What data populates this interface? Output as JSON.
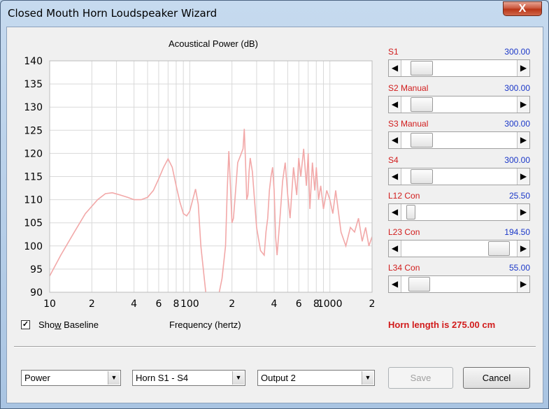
{
  "window": {
    "title": "Closed Mouth Horn Loudspeaker Wizard",
    "close_glyph": "X"
  },
  "chart": {
    "title": "Acoustical Power (dB)",
    "xlabel": "Frequency (hertz)"
  },
  "chart_data": {
    "type": "line",
    "title": "Acoustical Power (dB)",
    "xlabel": "Frequency (hertz)",
    "ylabel": "",
    "xscale": "log",
    "xlim": [
      10,
      2000
    ],
    "ylim": [
      90,
      140
    ],
    "yticks": [
      "140",
      "135",
      "130",
      "125",
      "120",
      "115",
      "110",
      "105",
      "100",
      "95",
      "90"
    ],
    "xticks": [
      {
        "v": 10,
        "label": "10"
      },
      {
        "v": 20,
        "label": "2"
      },
      {
        "v": 40,
        "label": "4"
      },
      {
        "v": 60,
        "label": "6"
      },
      {
        "v": 80,
        "label": "8"
      },
      {
        "v": 100,
        "label": "100"
      },
      {
        "v": 200,
        "label": "2"
      },
      {
        "v": 400,
        "label": "4"
      },
      {
        "v": 600,
        "label": "6"
      },
      {
        "v": 800,
        "label": "8"
      },
      {
        "v": 1000,
        "label": "1000"
      },
      {
        "v": 2000,
        "label": "2"
      }
    ],
    "grid": true,
    "series": [
      {
        "color": "#f2a8a8",
        "x": [
          10,
          12,
          15,
          18,
          22,
          25,
          28,
          32,
          36,
          40,
          45,
          50,
          55,
          60,
          65,
          70,
          75,
          80,
          85,
          90,
          95,
          100,
          105,
          110,
          115,
          120,
          130,
          140,
          150,
          160,
          170,
          180,
          185,
          190,
          195,
          200,
          205,
          210,
          220,
          230,
          240,
          245,
          250,
          255,
          260,
          265,
          270,
          280,
          300,
          320,
          340,
          350,
          360,
          370,
          380,
          390,
          400,
          410,
          420,
          440,
          460,
          480,
          500,
          520,
          550,
          580,
          600,
          620,
          650,
          680,
          700,
          720,
          750,
          780,
          800,
          830,
          860,
          900,
          950,
          1000,
          1050,
          1100,
          1200,
          1300,
          1400,
          1500,
          1600,
          1700,
          1800,
          1900,
          2000
        ],
        "y": [
          93.5,
          98,
          103,
          107,
          110,
          111.3,
          111.5,
          111,
          110.5,
          110,
          110,
          110.5,
          112,
          114.5,
          117,
          118.8,
          117,
          113,
          109.5,
          107,
          106.5,
          107.5,
          110,
          112.3,
          109,
          100,
          90,
          87,
          87,
          89,
          93,
          100,
          112,
          120.5,
          113,
          105,
          106,
          110,
          118,
          119.5,
          121,
          125.3,
          118,
          110,
          111,
          116,
          119,
          116,
          104,
          99,
          98,
          103,
          106,
          112,
          115,
          117,
          112,
          102,
          98,
          106,
          114,
          118,
          111,
          106,
          117,
          111,
          119,
          115,
          121,
          113,
          120,
          108,
          118,
          112,
          117,
          110,
          113,
          108,
          112,
          110,
          107,
          112,
          103,
          100,
          104,
          103,
          106,
          101,
          104,
          100,
          102
        ]
      }
    ]
  },
  "baseline": {
    "label_pre": "Sho",
    "label_accel": "w",
    "label_post": " Baseline",
    "checked": true,
    "check_glyph": "✓"
  },
  "sliders": [
    {
      "name": "S1",
      "value": "300.00",
      "thumb_pos": 0.08,
      "thumb_size": 0.19
    },
    {
      "name": "S2  Manual",
      "value": "300.00",
      "thumb_pos": 0.08,
      "thumb_size": 0.19
    },
    {
      "name": "S3  Manual",
      "value": "300.00",
      "thumb_pos": 0.08,
      "thumb_size": 0.19
    },
    {
      "name": "S4",
      "value": "300.00",
      "thumb_pos": 0.08,
      "thumb_size": 0.19
    },
    {
      "name": "L12  Con",
      "value": "25.50",
      "thumb_pos": 0.04,
      "thumb_size": 0.08
    },
    {
      "name": "L23  Con",
      "value": "194.50",
      "thumb_pos": 0.75,
      "thumb_size": 0.19
    },
    {
      "name": "L34  Con",
      "value": "55.00",
      "thumb_pos": 0.06,
      "thumb_size": 0.19
    }
  ],
  "arrows": {
    "left": "◀",
    "right": "▶",
    "down": "▼"
  },
  "horn_length": "Horn length is 275.00 cm",
  "dropdowns": [
    {
      "value": "Power"
    },
    {
      "value": "Horn S1 - S4"
    },
    {
      "value": "Output 2"
    }
  ],
  "buttons": {
    "save": "Save",
    "cancel": "Cancel"
  }
}
